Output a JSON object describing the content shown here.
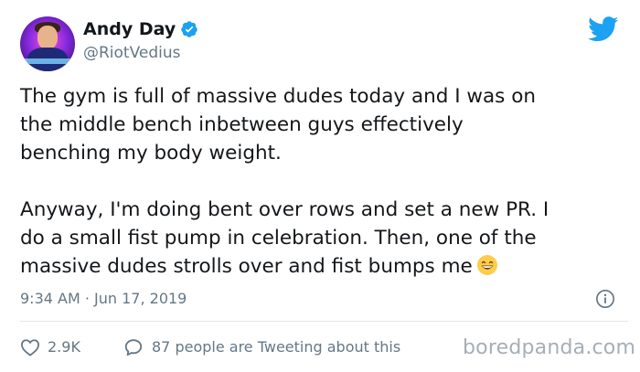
{
  "author": {
    "name": "Andy Day",
    "handle": "@RiotVedius",
    "verified": true
  },
  "icons": {
    "verified": "verified-badge-icon",
    "brand": "twitter-bird-icon",
    "info": "info-icon",
    "like": "heart-icon",
    "reply": "speech-bubble-icon",
    "emoji": "grinning-face-emoji"
  },
  "tweet": {
    "lines_p1": [
      "The gym is full of massive dudes today and I was on",
      "the middle bench inbetween guys effectively",
      "benching my body weight."
    ],
    "lines_p2": [
      "Anyway, I'm doing bent over rows and set a new PR. I",
      "do a small fist pump in celebration. Then, one of the",
      "massive dudes strolls over and fist bumps me"
    ],
    "timestamp": "9:34 AM · Jun 17, 2019"
  },
  "stats": {
    "likes": "2.9K",
    "replies_text": "87 people are Tweeting about this"
  },
  "watermark": "boredpanda.com",
  "colors": {
    "twitter_blue": "#1da1f2",
    "text": "#14171a",
    "secondary": "#657786",
    "divider": "#e1e8ed"
  }
}
